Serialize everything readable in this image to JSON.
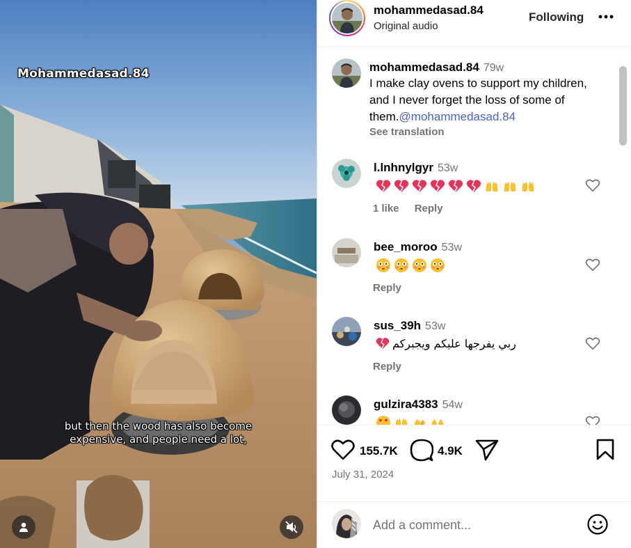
{
  "video": {
    "watermark": "Mohammedasad.84",
    "caption_line1": "but then the wood has also become",
    "caption_line2": "expensive, and people need a lot,"
  },
  "post": {
    "username": "mohammedasad.84",
    "audio": "Original audio",
    "follow_label": "Following",
    "caption": {
      "username": "mohammedasad.84",
      "time": "79w",
      "text": "I make clay ovens to support my children, and I never forget the loss of some of them.",
      "mention": "@mohammedasad.84",
      "see_translation": "See translation"
    },
    "comments": [
      {
        "username": "l.lnhnylgyr",
        "time": "53w",
        "likes": "1 like",
        "reply": "Reply"
      },
      {
        "username": "bee_moroo",
        "time": "53w",
        "reply": "Reply"
      },
      {
        "username": "sus_39h",
        "time": "53w",
        "text": "ربي يفرجها عليكم ويجبركم",
        "reply": "Reply"
      },
      {
        "username": "gulzira4383",
        "time": "54w"
      }
    ],
    "like_count": "155.7K",
    "comment_count": "4.9K",
    "date": "July 31, 2024",
    "comment_placeholder": "Add a comment..."
  },
  "icons": {
    "heart": "heart-icon",
    "comment": "comment-icon",
    "share": "paper-plane-icon",
    "save": "bookmark-icon",
    "emoji": "smiley-icon",
    "mute": "speaker-muted-icon",
    "user": "user-icon",
    "more": "ellipsis-icon"
  },
  "colors": {
    "mention": "#4a5ecf",
    "secondary_text": "#737373",
    "broken_heart": "#e8325a",
    "raised_hands": "#f7c22e"
  }
}
